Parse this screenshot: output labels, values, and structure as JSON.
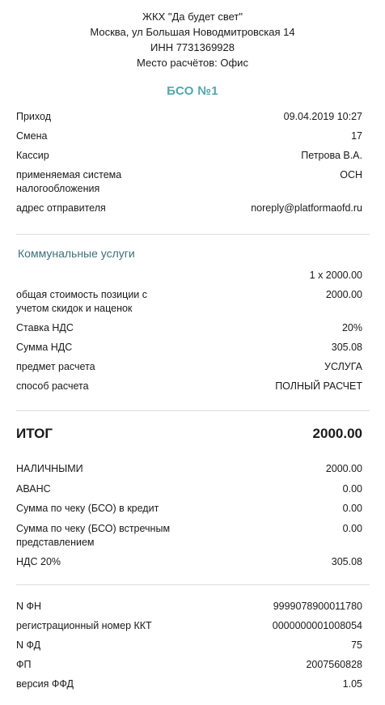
{
  "header": {
    "org": "ЖКХ \"Да будет свет\"",
    "address": "Москва, ул Большая Новодмитровская 14",
    "inn": "ИНН 7731369928",
    "place": "Место расчётов: Офис"
  },
  "title": "БСО №1",
  "info": [
    {
      "k": "Приход",
      "v": "09.04.2019 10:27"
    },
    {
      "k": "Смена",
      "v": "17"
    },
    {
      "k": "Кассир",
      "v": "Петрова В.А."
    },
    {
      "k": "применяемая система налогообложения",
      "v": "ОСН"
    },
    {
      "k": "адрес отправителя",
      "v": "noreply@platformaofd.ru"
    }
  ],
  "item": {
    "name": "Коммунальные услуги",
    "qty_price": "1 x 2000.00",
    "rows": [
      {
        "k": "общая стоимость позиции с учетом скидок и наценок",
        "v": "2000.00"
      },
      {
        "k": "Ставка НДС",
        "v": "20%"
      },
      {
        "k": "Сумма НДС",
        "v": "305.08"
      },
      {
        "k": "предмет расчета",
        "v": "УСЛУГА"
      },
      {
        "k": "способ расчета",
        "v": "ПОЛНЫЙ РАСЧЕТ"
      }
    ]
  },
  "total": {
    "label": "ИТОГ",
    "value": "2000.00"
  },
  "payments": [
    {
      "k": "НАЛИЧНЫМИ",
      "v": "2000.00"
    },
    {
      "k": "АВАНС",
      "v": "0.00"
    },
    {
      "k": "Сумма по чеку (БСО) в кредит",
      "v": "0.00"
    },
    {
      "k": "Сумма по чеку (БСО) встречным представлением",
      "v": "0.00"
    },
    {
      "k": "НДС 20%",
      "v": "305.08"
    }
  ],
  "fiscal": [
    {
      "k": "N ФН",
      "v": "9999078900011780"
    },
    {
      "k": "регистрационный номер ККТ",
      "v": "0000000001008054"
    },
    {
      "k": "N ФД",
      "v": "75"
    },
    {
      "k": "ФП",
      "v": "2007560828"
    },
    {
      "k": "версия ФФД",
      "v": "1.05"
    }
  ]
}
